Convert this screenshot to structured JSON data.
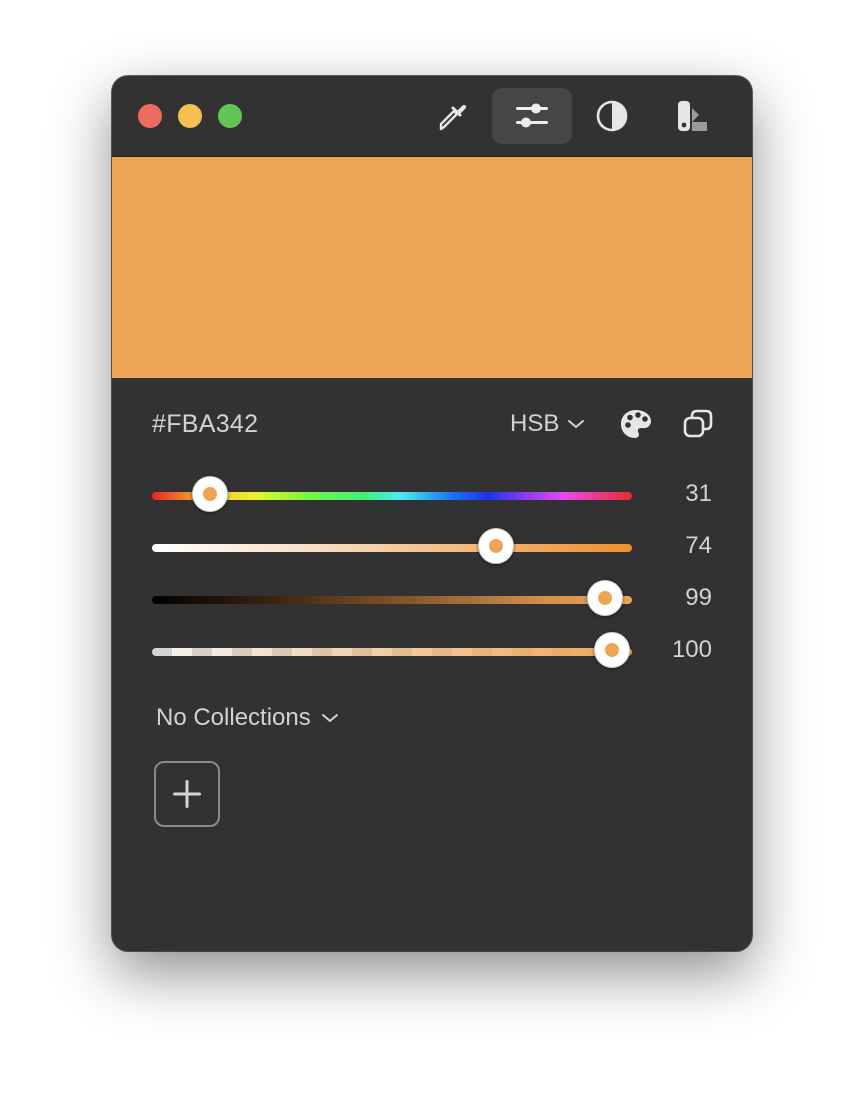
{
  "colors": {
    "window_bg": "#323232",
    "current": "#EFA556"
  },
  "toolbar": {
    "tools": [
      {
        "icon": "eyedropper-icon",
        "active": false
      },
      {
        "icon": "sliders-icon",
        "active": true
      },
      {
        "icon": "contrast-icon",
        "active": false
      },
      {
        "icon": "palette-swatch-icon",
        "active": false
      }
    ]
  },
  "color_info": {
    "hex": "#FBA342",
    "model": "HSB"
  },
  "sliders": [
    {
      "name": "hue",
      "value": "31",
      "fraction": 0.12
    },
    {
      "name": "saturation",
      "value": "74",
      "fraction": 0.717
    },
    {
      "name": "brightness",
      "value": "99",
      "fraction": 0.944
    },
    {
      "name": "opacity",
      "value": "100",
      "fraction": 0.958
    }
  ],
  "collections": {
    "label": "No Collections"
  }
}
